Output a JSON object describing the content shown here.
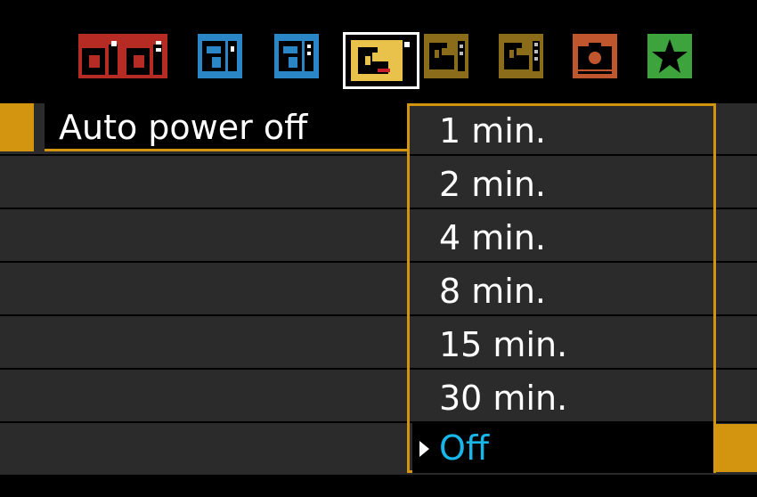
{
  "tabs": [
    {
      "icon": "camera-icon",
      "color": "#b62b24",
      "active": false
    },
    {
      "icon": "camera-icon",
      "color": "#b62b24",
      "active": false
    },
    {
      "icon": "playback-icon",
      "color": "#2b86c6",
      "active": false
    },
    {
      "icon": "playback-icon",
      "color": "#2b86c6",
      "active": false
    },
    {
      "icon": "wrench-icon",
      "color": "#e8c24a",
      "active": true
    },
    {
      "icon": "wrench-icon",
      "color": "#8a6c1a",
      "active": false
    },
    {
      "icon": "wrench-icon",
      "color": "#8a6c1a",
      "active": false
    },
    {
      "icon": "live-view-camera-icon",
      "color": "#c0562e",
      "active": false
    },
    {
      "icon": "star-icon",
      "color": "#3da43d",
      "active": false
    }
  ],
  "menu": {
    "selected_item_label": "Auto power off"
  },
  "dropdown": {
    "options": [
      "1 min.",
      "2 min.",
      "4 min.",
      "8 min.",
      "15 min.",
      "30 min.",
      "Off"
    ],
    "selected": "Off"
  },
  "colors": {
    "accent": "#d39410",
    "selected_text": "#19b6ea"
  }
}
